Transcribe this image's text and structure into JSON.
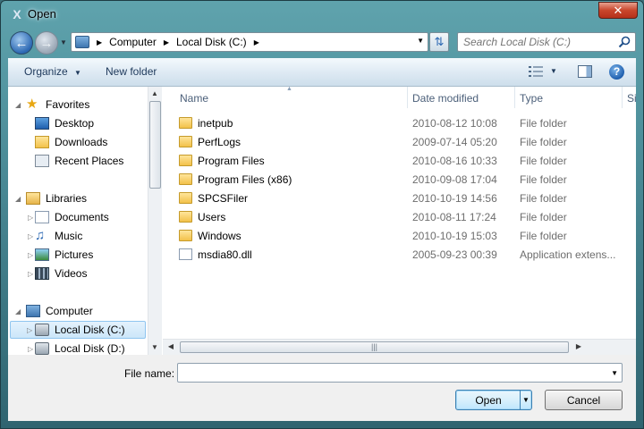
{
  "window": {
    "title": "Open",
    "close_label": "✕"
  },
  "address": {
    "crumbs": [
      "Computer",
      "Local Disk (C:)"
    ],
    "search_placeholder": "Search Local Disk (C:)"
  },
  "toolbar": {
    "organize_label": "Organize",
    "new_folder_label": "New folder"
  },
  "nav_pane": {
    "favorites": {
      "label": "Favorites",
      "items": [
        "Desktop",
        "Downloads",
        "Recent Places"
      ]
    },
    "libraries": {
      "label": "Libraries",
      "items": [
        "Documents",
        "Music",
        "Pictures",
        "Videos"
      ]
    },
    "computer": {
      "label": "Computer",
      "items": [
        "Local Disk (C:)",
        "Local Disk (D:)"
      ],
      "selected": "Local Disk (C:)"
    }
  },
  "columns": {
    "name": "Name",
    "date": "Date modified",
    "type": "Type",
    "size": "Si"
  },
  "files": [
    {
      "name": "inetpub",
      "date": "2010-08-12 10:08",
      "type": "File folder",
      "icon": "folder-icon"
    },
    {
      "name": "PerfLogs",
      "date": "2009-07-14 05:20",
      "type": "File folder",
      "icon": "folder-icon"
    },
    {
      "name": "Program Files",
      "date": "2010-08-16 10:33",
      "type": "File folder",
      "icon": "folder-icon"
    },
    {
      "name": "Program Files (x86)",
      "date": "2010-09-08 17:04",
      "type": "File folder",
      "icon": "folder-icon"
    },
    {
      "name": "SPCSFiler",
      "date": "2010-10-19 14:56",
      "type": "File folder",
      "icon": "folder-icon"
    },
    {
      "name": "Users",
      "date": "2010-08-11 17:24",
      "type": "File folder",
      "icon": "folder-icon"
    },
    {
      "name": "Windows",
      "date": "2010-10-19 15:03",
      "type": "File folder",
      "icon": "folder-icon"
    },
    {
      "name": "msdia80.dll",
      "date": "2005-09-23 00:39",
      "type": "Application extens...",
      "icon": "dll-file-icon"
    }
  ],
  "bottom": {
    "file_name_label": "File name:",
    "file_name_value": "",
    "open_label": "Open",
    "cancel_label": "Cancel"
  }
}
